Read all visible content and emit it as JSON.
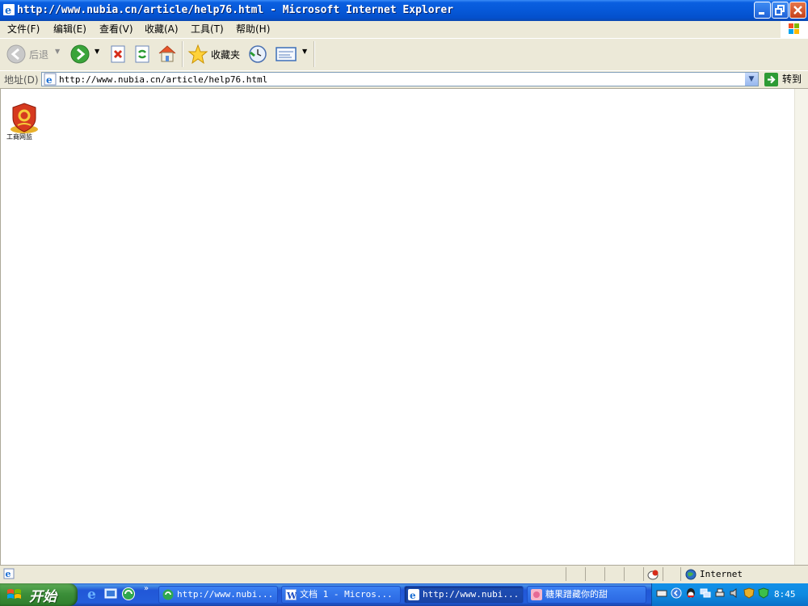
{
  "window": {
    "title": "http://www.nubia.cn/article/help76.html - Microsoft Internet Explorer"
  },
  "menu": {
    "items": [
      {
        "label": "文件(F)"
      },
      {
        "label": "编辑(E)"
      },
      {
        "label": "查看(V)"
      },
      {
        "label": "收藏(A)"
      },
      {
        "label": "工具(T)"
      },
      {
        "label": "帮助(H)"
      }
    ]
  },
  "toolbar": {
    "back_label": "后退",
    "favorites_label": "收藏夹",
    "icons": [
      "back-icon",
      "forward-icon",
      "stop-icon",
      "refresh-icon",
      "home-icon",
      "favorites-star-icon",
      "history-icon",
      "mail-icon"
    ]
  },
  "address": {
    "label": "地址(D)",
    "url": "http://www.nubia.cn/article/help76.html",
    "go_label": "转到"
  },
  "content": {
    "badge_caption": "工商网监"
  },
  "status": {
    "zone": "Internet"
  },
  "taskbar": {
    "start_label": "开始",
    "tasks": [
      {
        "label": "http://www.nubi..."
      },
      {
        "label": "文档 1 - Micros..."
      },
      {
        "label": "http://www.nubi..."
      },
      {
        "label": "糖果蹭藏你的甜"
      }
    ],
    "clock": "8:45"
  },
  "colors": {
    "titlebar": "#0658d8",
    "chrome": "#ece9d8",
    "taskbar": "#245edb",
    "start": "#3c8f3a",
    "tray": "#0f8ae0"
  }
}
